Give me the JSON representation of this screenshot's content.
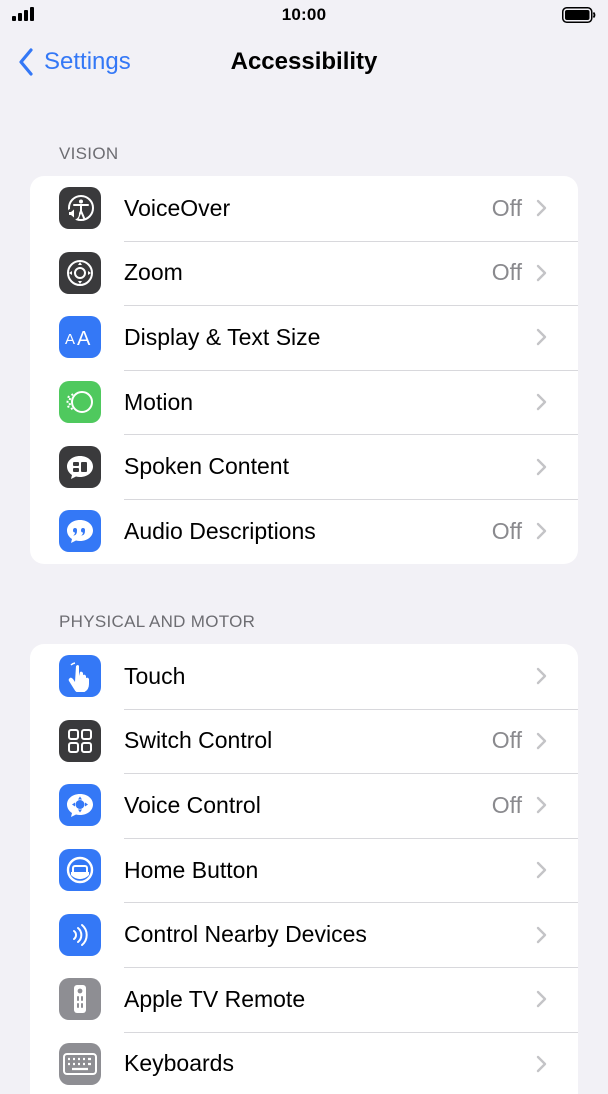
{
  "status_bar": {
    "time": "10:00"
  },
  "nav": {
    "back_label": "Settings",
    "title": "Accessibility"
  },
  "sections": [
    {
      "header": "VISION",
      "items": [
        {
          "label": "VoiceOver",
          "value": "Off",
          "icon": "voiceover-icon",
          "color": "#3a3a3c"
        },
        {
          "label": "Zoom",
          "value": "Off",
          "icon": "zoom-icon",
          "color": "#3a3a3c"
        },
        {
          "label": "Display & Text Size",
          "value": "",
          "icon": "text-size-icon",
          "color": "#3478f6"
        },
        {
          "label": "Motion",
          "value": "",
          "icon": "motion-icon",
          "color": "#4fc95e"
        },
        {
          "label": "Spoken Content",
          "value": "",
          "icon": "spoken-content-icon",
          "color": "#3a3a3c"
        },
        {
          "label": "Audio Descriptions",
          "value": "Off",
          "icon": "audio-descriptions-icon",
          "color": "#3478f6"
        }
      ]
    },
    {
      "header": "PHYSICAL AND MOTOR",
      "items": [
        {
          "label": "Touch",
          "value": "",
          "icon": "touch-icon",
          "color": "#3478f6"
        },
        {
          "label": "Switch Control",
          "value": "Off",
          "icon": "switch-control-icon",
          "color": "#3a3a3c"
        },
        {
          "label": "Voice Control",
          "value": "Off",
          "icon": "voice-control-icon",
          "color": "#3478f6"
        },
        {
          "label": "Home Button",
          "value": "",
          "icon": "home-button-icon",
          "color": "#3478f6"
        },
        {
          "label": "Control Nearby Devices",
          "value": "",
          "icon": "nearby-devices-icon",
          "color": "#3478f6"
        },
        {
          "label": "Apple TV Remote",
          "value": "",
          "icon": "tv-remote-icon",
          "color": "#8e8e93"
        },
        {
          "label": "Keyboards",
          "value": "",
          "icon": "keyboard-icon",
          "color": "#8e8e93"
        }
      ]
    }
  ],
  "colors": {
    "accent": "#3478f6",
    "background": "#f2f1f6",
    "secondary_text": "#8a8a8e"
  }
}
